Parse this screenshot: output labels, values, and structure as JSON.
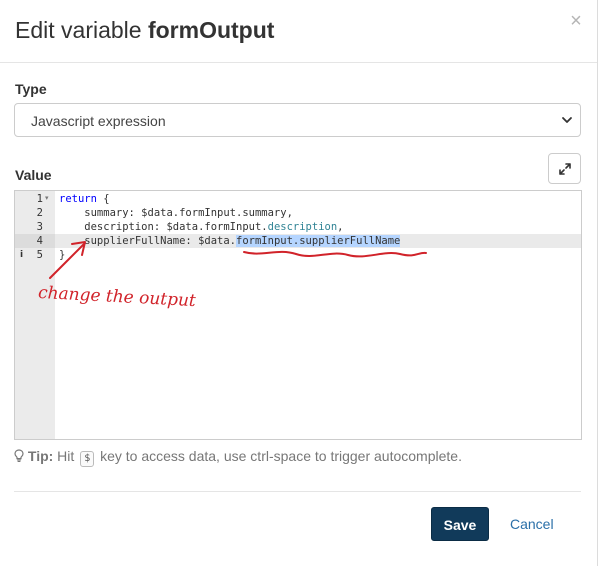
{
  "dialog": {
    "title_prefix": "Edit variable ",
    "title_name": "formOutput",
    "close_symbol": "×"
  },
  "type_field": {
    "label": "Type",
    "selected": "Javascript expression"
  },
  "value_field": {
    "label": "Value",
    "expand_icon": "expand-arrows-icon"
  },
  "editor": {
    "lines": [
      {
        "num": "1",
        "kw": "return",
        "rest": " {"
      },
      {
        "num": "2",
        "text": "    summary: $data.formInput.summary,"
      },
      {
        "num": "3",
        "pre": "    description: $data.formInput.",
        "prop": "description",
        "post": ","
      },
      {
        "num": "4",
        "pre": "    supplierFullName: $data.",
        "selected": "formInput.supplierFullName"
      },
      {
        "num": "5",
        "text": "}"
      }
    ],
    "fold_marker": "▾",
    "info_marker": "i"
  },
  "annotation": {
    "text": "change the output",
    "color": "#d1232a"
  },
  "tip": {
    "label": "Tip:",
    "pre": " Hit ",
    "key": "$",
    "post": " key to access data, use ctrl-space to trigger autocomplete."
  },
  "footer": {
    "save_label": "Save",
    "cancel_label": "Cancel"
  },
  "colors": {
    "primary": "#113a5a",
    "link": "#2a6fa8",
    "selection": "#b5d5ff"
  }
}
